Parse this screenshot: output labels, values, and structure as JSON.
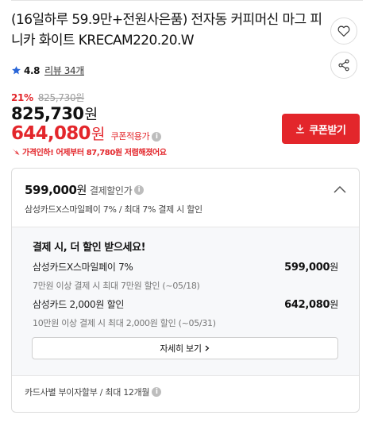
{
  "product": {
    "title": "(16일하루 59.9만+전원사은품) 전자동 커피머신 마그 피니카 화이트 KRECAM220.20.W",
    "rating": "4.8",
    "review_link": "리뷰 34개"
  },
  "pricing": {
    "discount_rate": "21%",
    "original_price": "825,730원",
    "sale_price_amount": "825,730",
    "sale_price_unit": "원",
    "coupon_price_amount": "644,080",
    "coupon_price_unit": "원",
    "coupon_price_label": "쿠폰적용가",
    "price_drop_notice": "가격인하! 어제부터 87,780원 저렴해졌어요",
    "coupon_button_label": "쿠폰받기"
  },
  "payment_card": {
    "price_amount": "599,000",
    "price_unit": "원",
    "price_label": "결제할인가",
    "summary": "삼성카드X스마일페이 7% / 최대 7% 결제 시 할인",
    "detail_heading": "결제 시, 더 할인 받으세요!",
    "offers": [
      {
        "name": "삼성카드X스마일페이 7%",
        "description": "7만원 이상 결제 시 최대 7만원 할인 (~05/18)",
        "price_amount": "599,000",
        "price_unit": "원"
      },
      {
        "name": "삼성카드 2,000원 할인",
        "description": "10만원 이상 결제 시 최대 2,000원 할인 (~05/31)",
        "price_amount": "642,080",
        "price_unit": "원"
      }
    ],
    "detail_button_label": "자세히 보기",
    "installment_text": "카드사별 부이자할부 / 최대 12개월"
  },
  "icons": {
    "wishlist": "heart-icon",
    "share": "share-icon",
    "rating": "star-icon",
    "info": "info-icon",
    "download": "download-icon",
    "collapse": "chevron-up-icon",
    "more": "chevron-right-icon",
    "price_drop": "arrow-down-icon"
  },
  "colors": {
    "accent_red": "#e3262b",
    "star_blue": "#2a66d8",
    "panel_background": "#f7f8fa"
  },
  "info_glyph": "i"
}
